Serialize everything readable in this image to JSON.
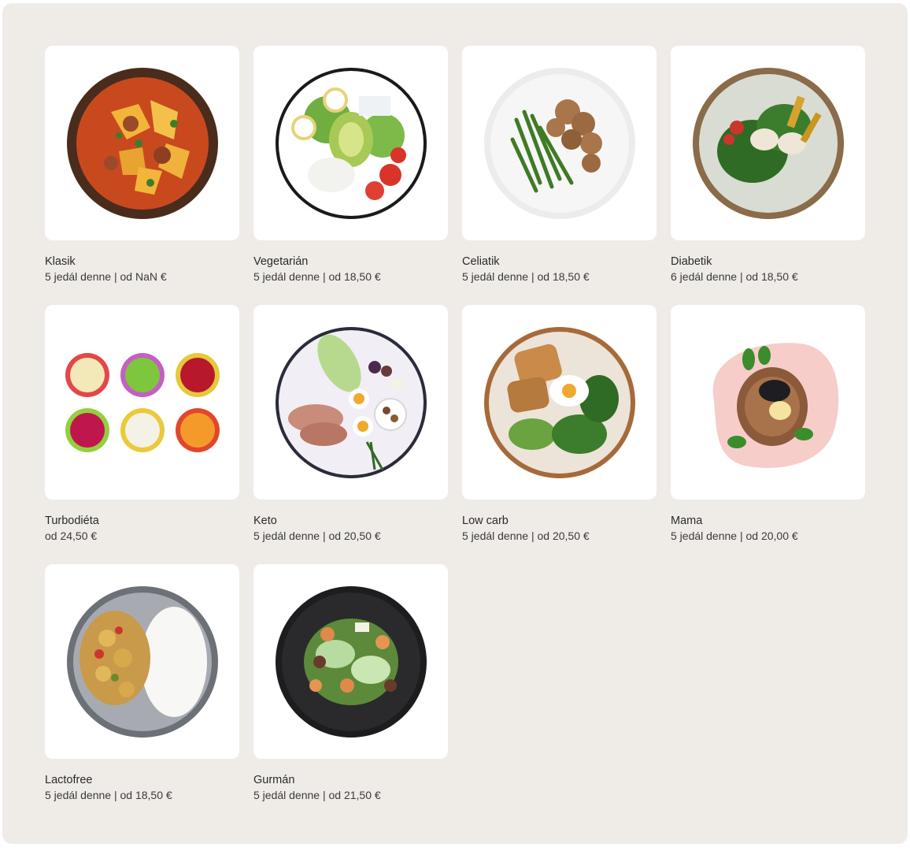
{
  "plans": [
    {
      "id": "klasik",
      "name": "Klasik",
      "meta": "5 jedál denne | od NaN €",
      "icon": "stew-bowl-icon"
    },
    {
      "id": "vegetarian",
      "name": "Vegetarián",
      "meta": "5 jedál denne | od 18,50 €",
      "icon": "salad-bowl-icon"
    },
    {
      "id": "celiatik",
      "name": "Celiatik",
      "meta": "5 jedál denne | od 18,50 €",
      "icon": "chicken-beans-plate-icon"
    },
    {
      "id": "diabetik",
      "name": "Diabetik",
      "meta": "6 jedál denne | od 18,50 €",
      "icon": "greens-plate-icon"
    },
    {
      "id": "turbodieta",
      "name": "Turbodiéta",
      "meta": "od 24,50 €",
      "icon": "soup-pots-icon"
    },
    {
      "id": "keto",
      "name": "Keto",
      "meta": "5 jedál denne | od 20,50 €",
      "icon": "keto-plate-icon"
    },
    {
      "id": "low-carb",
      "name": "Low carb",
      "meta": "5 jedál denne | od 20,50 €",
      "icon": "egg-toast-plate-icon"
    },
    {
      "id": "mama",
      "name": "Mama",
      "meta": "5 jedál denne | od 20,00 €",
      "icon": "pink-plate-icon"
    },
    {
      "id": "lactofree",
      "name": "Lactofree",
      "meta": "5 jedál denne | od 18,50 €",
      "icon": "rice-curry-plate-icon"
    },
    {
      "id": "gurman",
      "name": "Gurmán",
      "meta": "5 jedál denne | od 21,50 €",
      "icon": "shrimp-salad-plate-icon"
    }
  ]
}
